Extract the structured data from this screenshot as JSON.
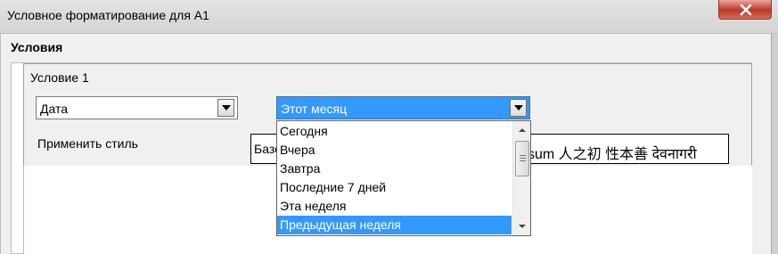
{
  "window": {
    "title": "Условное форматирование для A1"
  },
  "conditions": {
    "section_title": "Условия",
    "condition_label": "Условие 1",
    "type_combo": {
      "value": "Дата"
    },
    "date_combo": {
      "value": "Этот месяц"
    },
    "apply_style": {
      "label": "Применить стиль",
      "value_partial": "Базо",
      "preview": "sum   人之初 性本善   देवनागरी"
    }
  },
  "dropdown": {
    "items": [
      {
        "label": "Сегодня",
        "selected": false
      },
      {
        "label": "Вчера",
        "selected": false
      },
      {
        "label": "Завтра",
        "selected": false
      },
      {
        "label": "Последние 7 дней",
        "selected": false
      },
      {
        "label": "Эта неделя",
        "selected": false
      },
      {
        "label": "Предыдущая неделя",
        "selected": true
      }
    ]
  },
  "colors": {
    "selection": "#3399ff",
    "close_button": "#c7463a"
  },
  "icons": {
    "close": "close-icon",
    "dropdown": "chevron-down-icon",
    "scroll_up": "scroll-up-arrow-icon",
    "scroll_down": "scroll-down-arrow-icon"
  }
}
